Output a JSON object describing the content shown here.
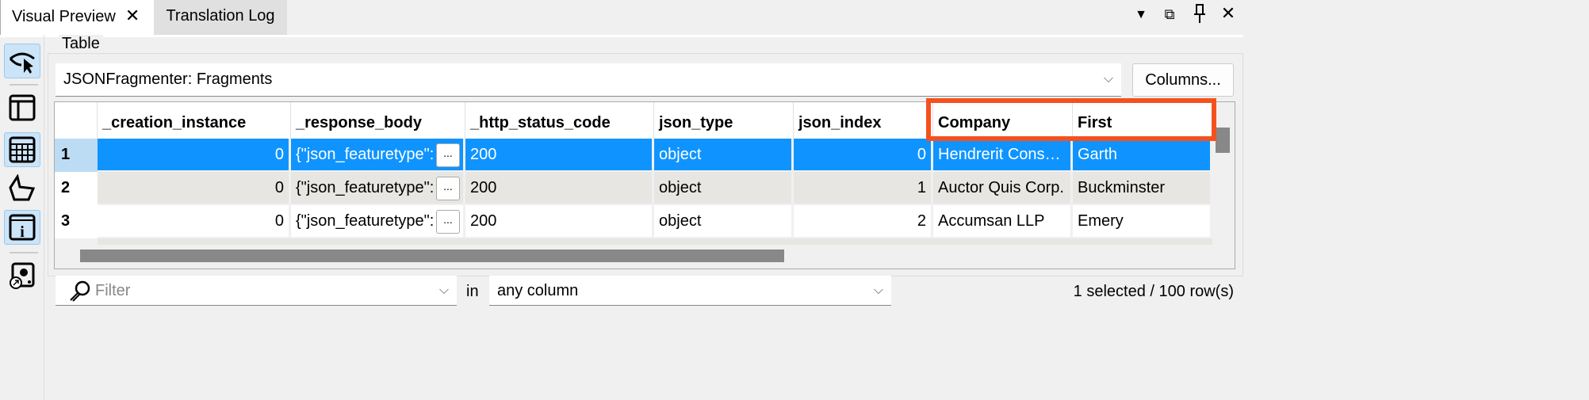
{
  "tabs": [
    {
      "label": "Visual Preview",
      "active": true,
      "closable": true
    },
    {
      "label": "Translation Log",
      "active": false
    }
  ],
  "window_controls": [
    "menu-dropdown-icon",
    "float-icon",
    "pin-icon",
    "close-icon"
  ],
  "sidebar": {
    "items": [
      {
        "icon": "eye-cursor-icon",
        "active": true
      },
      {
        "icon": "layout-panel-icon",
        "active": false
      },
      {
        "icon": "table-grid-icon",
        "active": true
      },
      {
        "icon": "polygon-icon",
        "active": false
      },
      {
        "icon": "info-icon",
        "active": true
      },
      {
        "icon": "disk-export-icon",
        "active": false
      }
    ]
  },
  "group": {
    "label": "Table"
  },
  "source": {
    "value": "JSONFragmenter: Fragments"
  },
  "columns_button": "Columns...",
  "table": {
    "columns": [
      "_creation_instance",
      "_response_body",
      "_http_status_code",
      "json_type",
      "json_index",
      "Company",
      "First"
    ],
    "rows": [
      {
        "n": "1",
        "cells": [
          "0",
          "{\"json_featuretype\":",
          "200",
          "object",
          "0",
          "Hendrerit Consectetuer",
          "Garth"
        ],
        "selected": true
      },
      {
        "n": "2",
        "cells": [
          "0",
          "{\"json_featuretype\":",
          "200",
          "object",
          "1",
          "Auctor Quis Corp.",
          "Buckminster"
        ]
      },
      {
        "n": "3",
        "cells": [
          "0",
          "{\"json_featuretype\":",
          "200",
          "object",
          "2",
          "Accumsan LLP",
          "Emery"
        ]
      }
    ],
    "ellipsis_label": "...",
    "highlighted_columns": [
      "Company",
      "First"
    ],
    "highlight_color": "#f4511e",
    "selection_color": "#0f94ff"
  },
  "filter": {
    "placeholder": "Filter",
    "in_label": "in",
    "column_value": "any column"
  },
  "status": "1 selected / 100 row(s)"
}
